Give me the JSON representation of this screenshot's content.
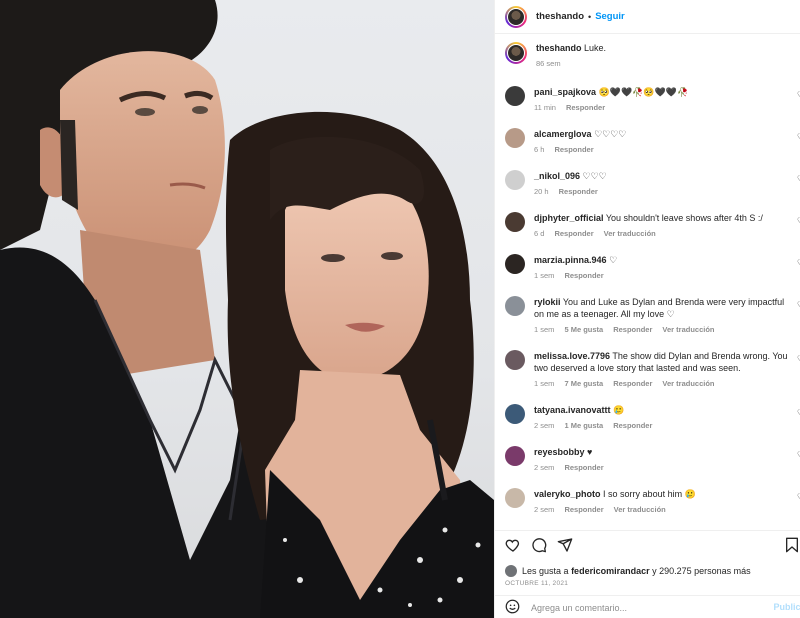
{
  "post": {
    "author": "theshando",
    "separator": "•",
    "follow_label": "Seguir",
    "caption_text": "Luke.",
    "caption_time": "86 sem"
  },
  "comments": [
    {
      "user": "pani_spajkova",
      "text": "🥺🖤🖤🥀🥺🖤🖤🥀",
      "time": "11 min",
      "likes": "",
      "reply": "Responder",
      "translate": "",
      "avatar_color": "#3a3a3a"
    },
    {
      "user": "alcamerglova",
      "text": "♡♡♡♡",
      "time": "6 h",
      "likes": "",
      "reply": "Responder",
      "translate": "",
      "avatar_color": "#b79a88"
    },
    {
      "user": "_nikol_096",
      "text": "♡♡♡",
      "time": "20 h",
      "likes": "",
      "reply": "Responder",
      "translate": "",
      "avatar_color": "#cfcfcf"
    },
    {
      "user": "djphyter_official",
      "text": "You shouldn't leave shows after 4th S :/",
      "time": "6 d",
      "likes": "",
      "reply": "Responder",
      "translate": "Ver traducción",
      "avatar_color": "#4a3a32"
    },
    {
      "user": "marzia.pinna.946",
      "text": "♡",
      "time": "1 sem",
      "likes": "",
      "reply": "Responder",
      "translate": "",
      "avatar_color": "#2b2522"
    },
    {
      "user": "rylokii",
      "text": "You and Luke as Dylan and Brenda were very impactful on me as a teenager. All my love ♡",
      "time": "1 sem",
      "likes": "5 Me gusta",
      "reply": "Responder",
      "translate": "Ver traducción",
      "avatar_color": "#8a9098"
    },
    {
      "user": "melissa.love.7796",
      "text": "The show did Dylan and Brenda wrong. You two deserved a love story that lasted and was seen.",
      "time": "1 sem",
      "likes": "7 Me gusta",
      "reply": "Responder",
      "translate": "Ver traducción",
      "avatar_color": "#6a5a60"
    },
    {
      "user": "tatyana.ivanovattt",
      "text": "🥲",
      "time": "2 sem",
      "likes": "1 Me gusta",
      "reply": "Responder",
      "translate": "",
      "avatar_color": "#3c5a78"
    },
    {
      "user": "reyesbobby",
      "text": "♥",
      "time": "2 sem",
      "likes": "",
      "reply": "Responder",
      "translate": "",
      "avatar_color": "#7a3a6a"
    },
    {
      "user": "valeryko_photo",
      "text": "I so sorry about him 🥲",
      "time": "2 sem",
      "likes": "",
      "reply": "Responder",
      "translate": "Ver traducción",
      "avatar_color": "#c8b8a8"
    }
  ],
  "likes": {
    "prefix": "Les gusta a",
    "user": "federicomirandacr",
    "suffix": "y 290.275 personas más"
  },
  "date": "OCTUBRE 11, 2021",
  "add_comment": {
    "placeholder": "Agrega un comentario...",
    "publish": "Publicar"
  },
  "icons": {
    "like": "heart-icon",
    "comment": "comment-icon",
    "share": "share-icon",
    "save": "bookmark-icon",
    "emoji": "emoji-icon"
  }
}
